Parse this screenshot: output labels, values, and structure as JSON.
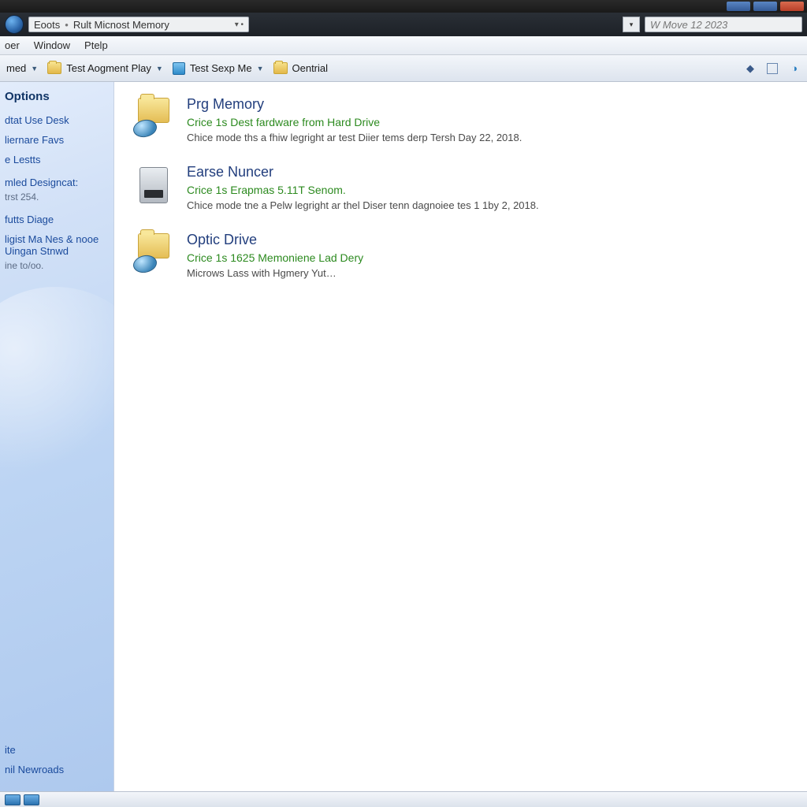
{
  "addressbar": {
    "segment1": "Eoots",
    "segment2": "Rult Micnost Memory",
    "search_placeholder": "W Move 12 2023"
  },
  "menubar": {
    "m0": "oer",
    "m1": "Window",
    "m2": "Ptelp"
  },
  "toolbar": {
    "t0": "med",
    "t1": "Test Aogment Play",
    "t2": "Test Sexp Me",
    "t3": "Oentrial"
  },
  "sidebar": {
    "heading": "Options",
    "links": {
      "l0": "dtat Use Desk",
      "l1": "liernare Favs",
      "l2": "e Lestts",
      "l3": "mled Designcat:",
      "l3sub": "trst 254.",
      "l4": "futts Diage",
      "l5": "ligist Ma Nes & nooe Uingan Stnwd",
      "l5sub": "ine to/oo."
    },
    "bottom": {
      "b0": "ite",
      "b1": "nil Newroads"
    }
  },
  "content": {
    "items": [
      {
        "icon": "folder-disc",
        "title": "Prg Memory",
        "subtitle": "Crice 1s Dest fardware from Hard Drive",
        "desc": "Chice mode ths a fhiw legright ar test Diier tems derp Tersh Day 22, 2018."
      },
      {
        "icon": "hdd",
        "title": "Earse Nuncer",
        "subtitle": "Crice 1s Erapmas 5.11T Senom.",
        "desc": "Chice mode tne a Pelw legright ar thel Diser tenn dagnoiee tes 1 1by 2, 2018."
      },
      {
        "icon": "folder-disc",
        "title": "Optic Drive",
        "subtitle": "Crice 1s 1625 Memoniene Lad Dery",
        "desc": "Microws Lass with Hgmery Yut…"
      }
    ]
  }
}
